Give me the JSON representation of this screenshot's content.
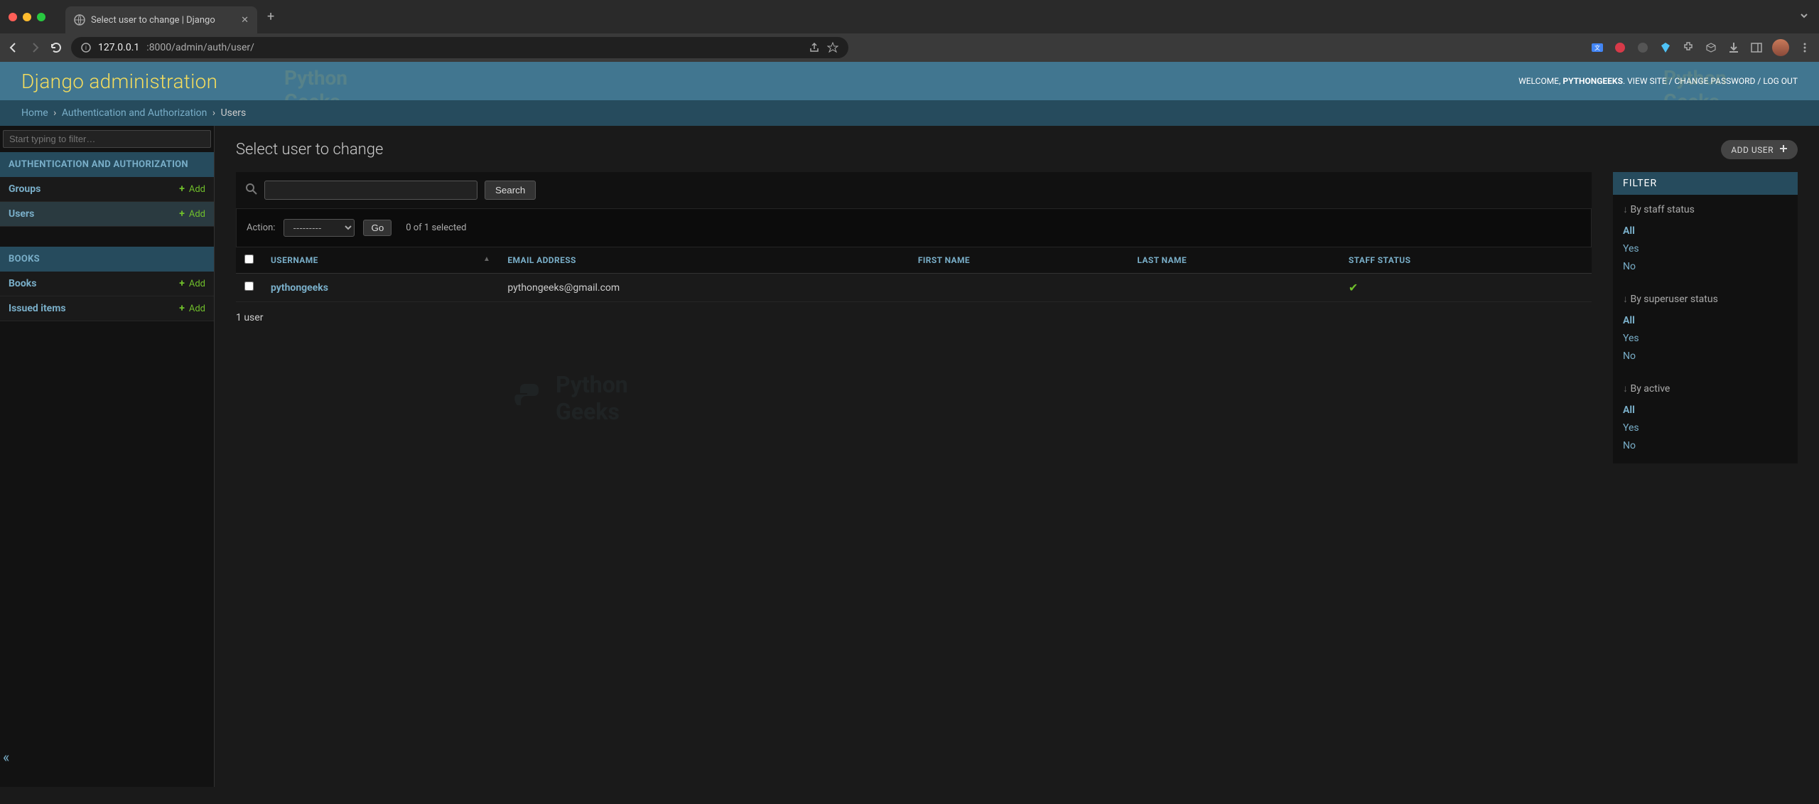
{
  "browser": {
    "tab_title": "Select user to change | Django",
    "url_host": "127.0.0.1",
    "url_path": ":8000/admin/auth/user/",
    "new_tab": "+"
  },
  "header": {
    "site_name": "Django administration",
    "welcome": "WELCOME, ",
    "username": "PYTHONGEEKS",
    "view_site": "VIEW SITE",
    "change_password": "CHANGE PASSWORD",
    "log_out": "LOG OUT",
    "sep": " / ",
    "watermark_top": "Python",
    "watermark_bottom": "Geeks"
  },
  "breadcrumbs": {
    "home": "Home",
    "app": "Authentication and Authorization",
    "model": "Users",
    "sep": "›"
  },
  "sidebar": {
    "filter_placeholder": "Start typing to filter…",
    "apps": [
      {
        "caption": "AUTHENTICATION AND AUTHORIZATION",
        "models": [
          {
            "name": "Groups",
            "add": "Add",
            "current": false
          },
          {
            "name": "Users",
            "add": "Add",
            "current": true
          }
        ]
      },
      {
        "caption": "BOOKS",
        "models": [
          {
            "name": "Books",
            "add": "Add",
            "current": false
          },
          {
            "name": "Issued items",
            "add": "Add",
            "current": false
          }
        ]
      }
    ],
    "collapse": "«"
  },
  "content": {
    "title": "Select user to change",
    "add_button": "ADD USER",
    "search_button": "Search",
    "actions": {
      "label": "Action:",
      "placeholder": "---------",
      "go": "Go",
      "counter": "0 of 1 selected"
    },
    "columns": {
      "username": "USERNAME",
      "email": "EMAIL ADDRESS",
      "first_name": "FIRST NAME",
      "last_name": "LAST NAME",
      "staff_status": "STAFF STATUS"
    },
    "rows": [
      {
        "username": "pythongeeks",
        "email": "pythongeeks@gmail.com",
        "first_name": "",
        "last_name": "",
        "staff": true
      }
    ],
    "paginator": "1 user"
  },
  "filter": {
    "header": "FILTER",
    "groups": [
      {
        "title": "By staff status",
        "options": [
          "All",
          "Yes",
          "No"
        ],
        "selected": "All"
      },
      {
        "title": "By superuser status",
        "options": [
          "All",
          "Yes",
          "No"
        ],
        "selected": "All"
      },
      {
        "title": "By active",
        "options": [
          "All",
          "Yes",
          "No"
        ],
        "selected": "All"
      }
    ]
  }
}
